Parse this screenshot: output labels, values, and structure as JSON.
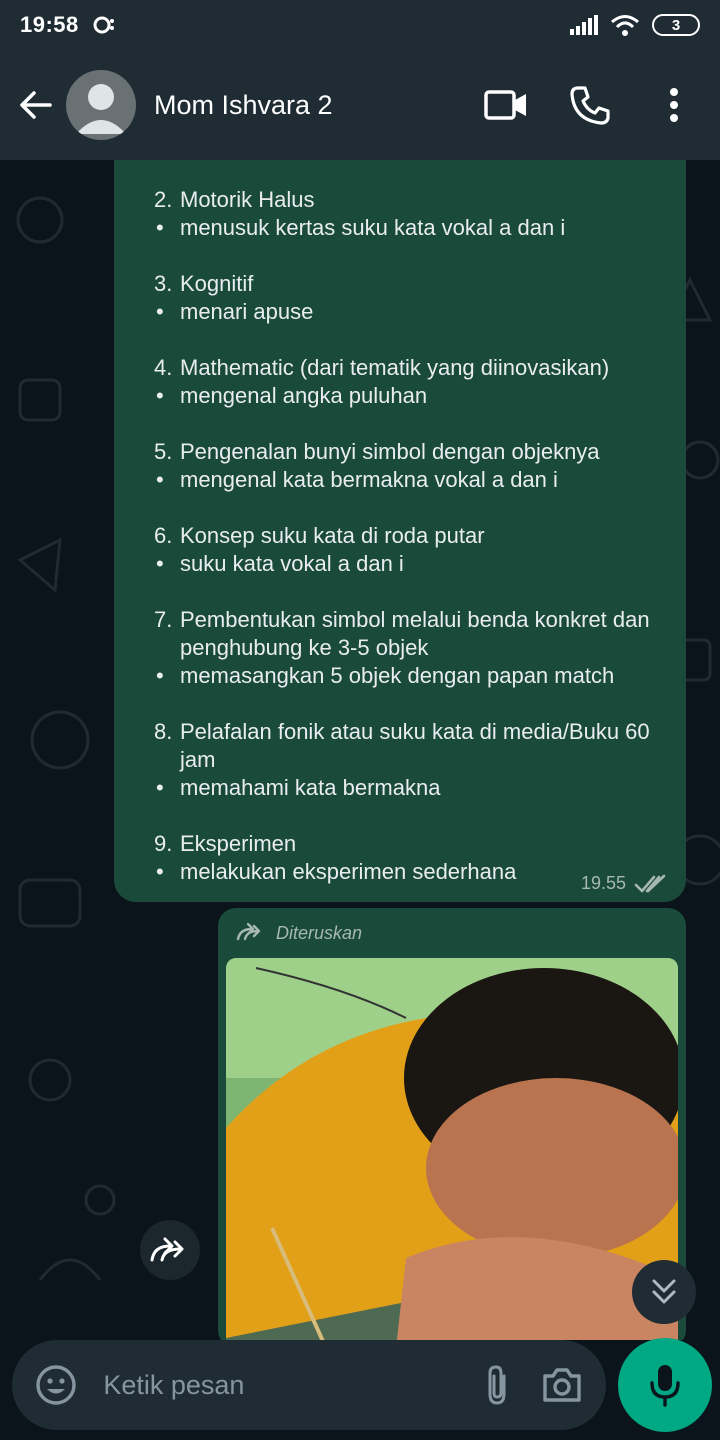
{
  "status_bar": {
    "time": "19:58",
    "battery": "3"
  },
  "header": {
    "contact_name": "Mom Ishvara 2"
  },
  "message": {
    "items": [
      {
        "num": "2.",
        "title": "Motorik Halus",
        "bullet": "menusuk kertas suku kata vokal a dan i"
      },
      {
        "num": "3.",
        "title": "Kognitif",
        "bullet": "menari apuse"
      },
      {
        "num": "4.",
        "title": "Mathematic (dari tematik yang diinovasikan)",
        "bullet": "mengenal angka puluhan"
      },
      {
        "num": "5.",
        "title": "Pengenalan bunyi simbol dengan objeknya",
        "bullet": "mengenal kata bermakna vokal a dan i"
      },
      {
        "num": "6.",
        "title": "Konsep suku kata di roda putar",
        "bullet": "suku kata vokal a dan i"
      },
      {
        "num": "7.",
        "title": "Pembentukan simbol melalui benda konkret dan penghubung ke 3-5 objek",
        "bullet": "memasangkan 5 objek dengan papan match"
      },
      {
        "num": "8.",
        "title": "Pelafalan fonik atau suku kata di media/Buku 60 jam",
        "bullet": "memahami kata bermakna"
      },
      {
        "num": "9.",
        "title": "Eksperimen",
        "bullet": "melakukan eksperimen sederhana"
      }
    ],
    "bullet_char": "•",
    "time": "19.55"
  },
  "forwarded": {
    "label": "Diteruskan"
  },
  "composer": {
    "placeholder": "Ketik pesan"
  },
  "colors": {
    "bubble_out": "#1a4a3a",
    "accent": "#00a884",
    "bar": "#1f2c34"
  },
  "icons": {
    "back": "arrow-left-icon",
    "video": "video-call-icon",
    "phone": "phone-icon",
    "menu": "more-vert-icon",
    "forward": "forward-icon",
    "emoji": "emoji-icon",
    "attach": "attach-icon",
    "camera": "camera-icon",
    "mic": "mic-icon",
    "scroll": "chevron-double-down-icon"
  }
}
